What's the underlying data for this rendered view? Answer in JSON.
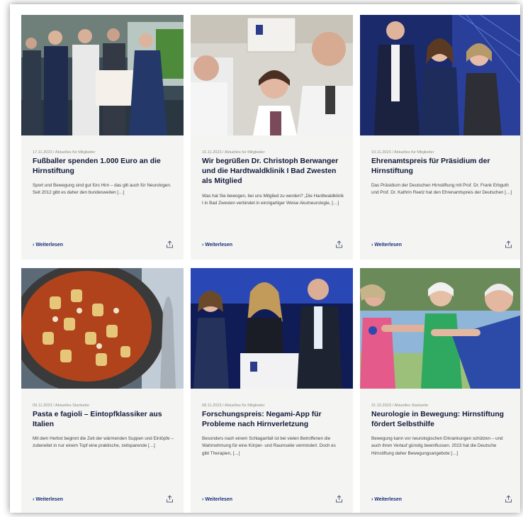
{
  "actions": {
    "read_more_label": "Weiterlesen",
    "share_icon": "share-icon",
    "read_more_icon": "chevron-right-icon"
  },
  "colors": {
    "card_bg": "#f4f4f2",
    "title": "#121a3a",
    "link": "#1b2e7a",
    "meta": "#8a8a8a"
  },
  "articles": [
    {
      "meta": "17.11.2023 / Aktuelles für Mitglieder",
      "title": "Fußballer spenden 1.000 Euro an die Hirnstiftung",
      "excerpt": "Sport und Bewegung sind gut fürs Hirn – das gilt auch für Neurologen. Seit 2012 gibt es daher den bundesweiten […]"
    },
    {
      "meta": "16.11.2023 / Aktuelles für Mitglieder",
      "title": "Wir begrüßen Dr. Christoph Ber­wanger und die Hardtwaldklinik I Bad Zwesten als Mitglied",
      "excerpt": "Was hat Sie bewogen, bei uns Mitglied zu werden? „Die Hardtwaldklinik I in Bad Zwesten verbindet in einzigartiger Weise Akutneurologie, […]"
    },
    {
      "meta": "10.11.2023 / Aktuelles für Mitglieder",
      "title": "Ehrenamtspreis für Präsidium der Hirnstiftung",
      "excerpt": "Das Präsidium der Deutschen Hirnstiftung mit Prof. Dr. Frank Erbguth und Prof. Dr. Kathrin Reetz hat den Ehrenamtspreis der Deutschen […]"
    },
    {
      "meta": "09.11.2023 / Aktuelles Startseite",
      "title": "Pasta e fagioli – Eintopfklassiker aus Italien",
      "excerpt": "Mit dem Herbst beginnt die Zeit der wärmenden Sup­pen und Eintöpfe – zubereitet in nur einem Topf eine praktische, zeitsparende […]"
    },
    {
      "meta": "08.11.2023 / Aktuelles für Mitglieder",
      "title": "Forschungspreis: Negami-App für Probleme nach Hirnverletzung",
      "excerpt": "Besonders nach einem Schlaganfall ist bei vielen Betroffenen die Wahrnehmung für eine Körper- und Raumseite vermindert. Doch es gibt Therapien, […]"
    },
    {
      "meta": "31.10.2023 / Aktuelles Startseite",
      "title": "Neurologie in Bewegung: Hirnstif­tung fördert Selbsthilfe",
      "excerpt": "Bewegung kann vor neurologischen Erkrankungen schützen – und auch ihren Verlauf günstig beeinflus­sen. 2023 hat die Deutsche Hirnstiftung daher Bewe­gungsangebote […]"
    }
  ]
}
